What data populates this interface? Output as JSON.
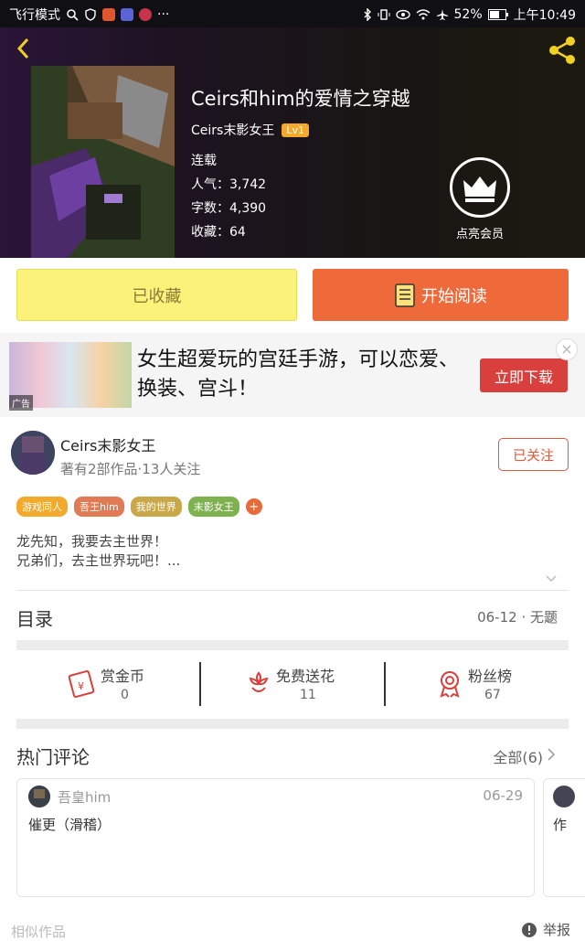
{
  "status_bar": {
    "left_text": "飞行模式",
    "battery": "52%",
    "time": "上午10:49"
  },
  "book": {
    "title": "Ceirs和him的爱情之穿越",
    "author": "Ceirs末影女王",
    "level": "Lv1",
    "status": "连载",
    "popularity": "人气：3,742",
    "word_count": "字数：4,390",
    "favorites": "收藏：64",
    "vip_label": "点亮会员"
  },
  "actions": {
    "collected_label": "已收藏",
    "read_label": "开始阅读"
  },
  "ad": {
    "text": "女生超爱玩的宫廷手游，可以恋爱、换装、宫斗！",
    "tag": "广告",
    "button": "立即下载"
  },
  "author_section": {
    "name": "Ceirs末影女王",
    "subtitle": "著有2部作品·13人关注",
    "follow_label": "已关注",
    "tags": [
      "游戏同人",
      "吾王him",
      "我的世界",
      "末影女王"
    ],
    "tag_colors": [
      "#f2a92c",
      "#e07b56",
      "#c9a84a",
      "#7eb24f"
    ],
    "description": [
      "龙先知，我要去主世界！",
      "兄弟们，去主世界玩吧！..."
    ]
  },
  "toc": {
    "title": "目录",
    "latest": "06-12 · 无题"
  },
  "stats": [
    {
      "label": "赏金币",
      "value": "0"
    },
    {
      "label": "免费送花",
      "value": "11"
    },
    {
      "label": "粉丝榜",
      "value": "67"
    }
  ],
  "comments": {
    "title": "热门评论",
    "all_label": "全部(6)",
    "items": [
      {
        "user": "吾皇him",
        "date": "06-29",
        "text": "催更（滑稽）"
      }
    ],
    "peek_text": "作"
  },
  "footer": {
    "similar": "相似作品",
    "report": "举报"
  },
  "colors": {
    "accent_orange": "#ef6a3a",
    "collected_yellow": "#fbf27a",
    "follow_red": "#e05a3c",
    "share_yellow": "#f2d020"
  }
}
